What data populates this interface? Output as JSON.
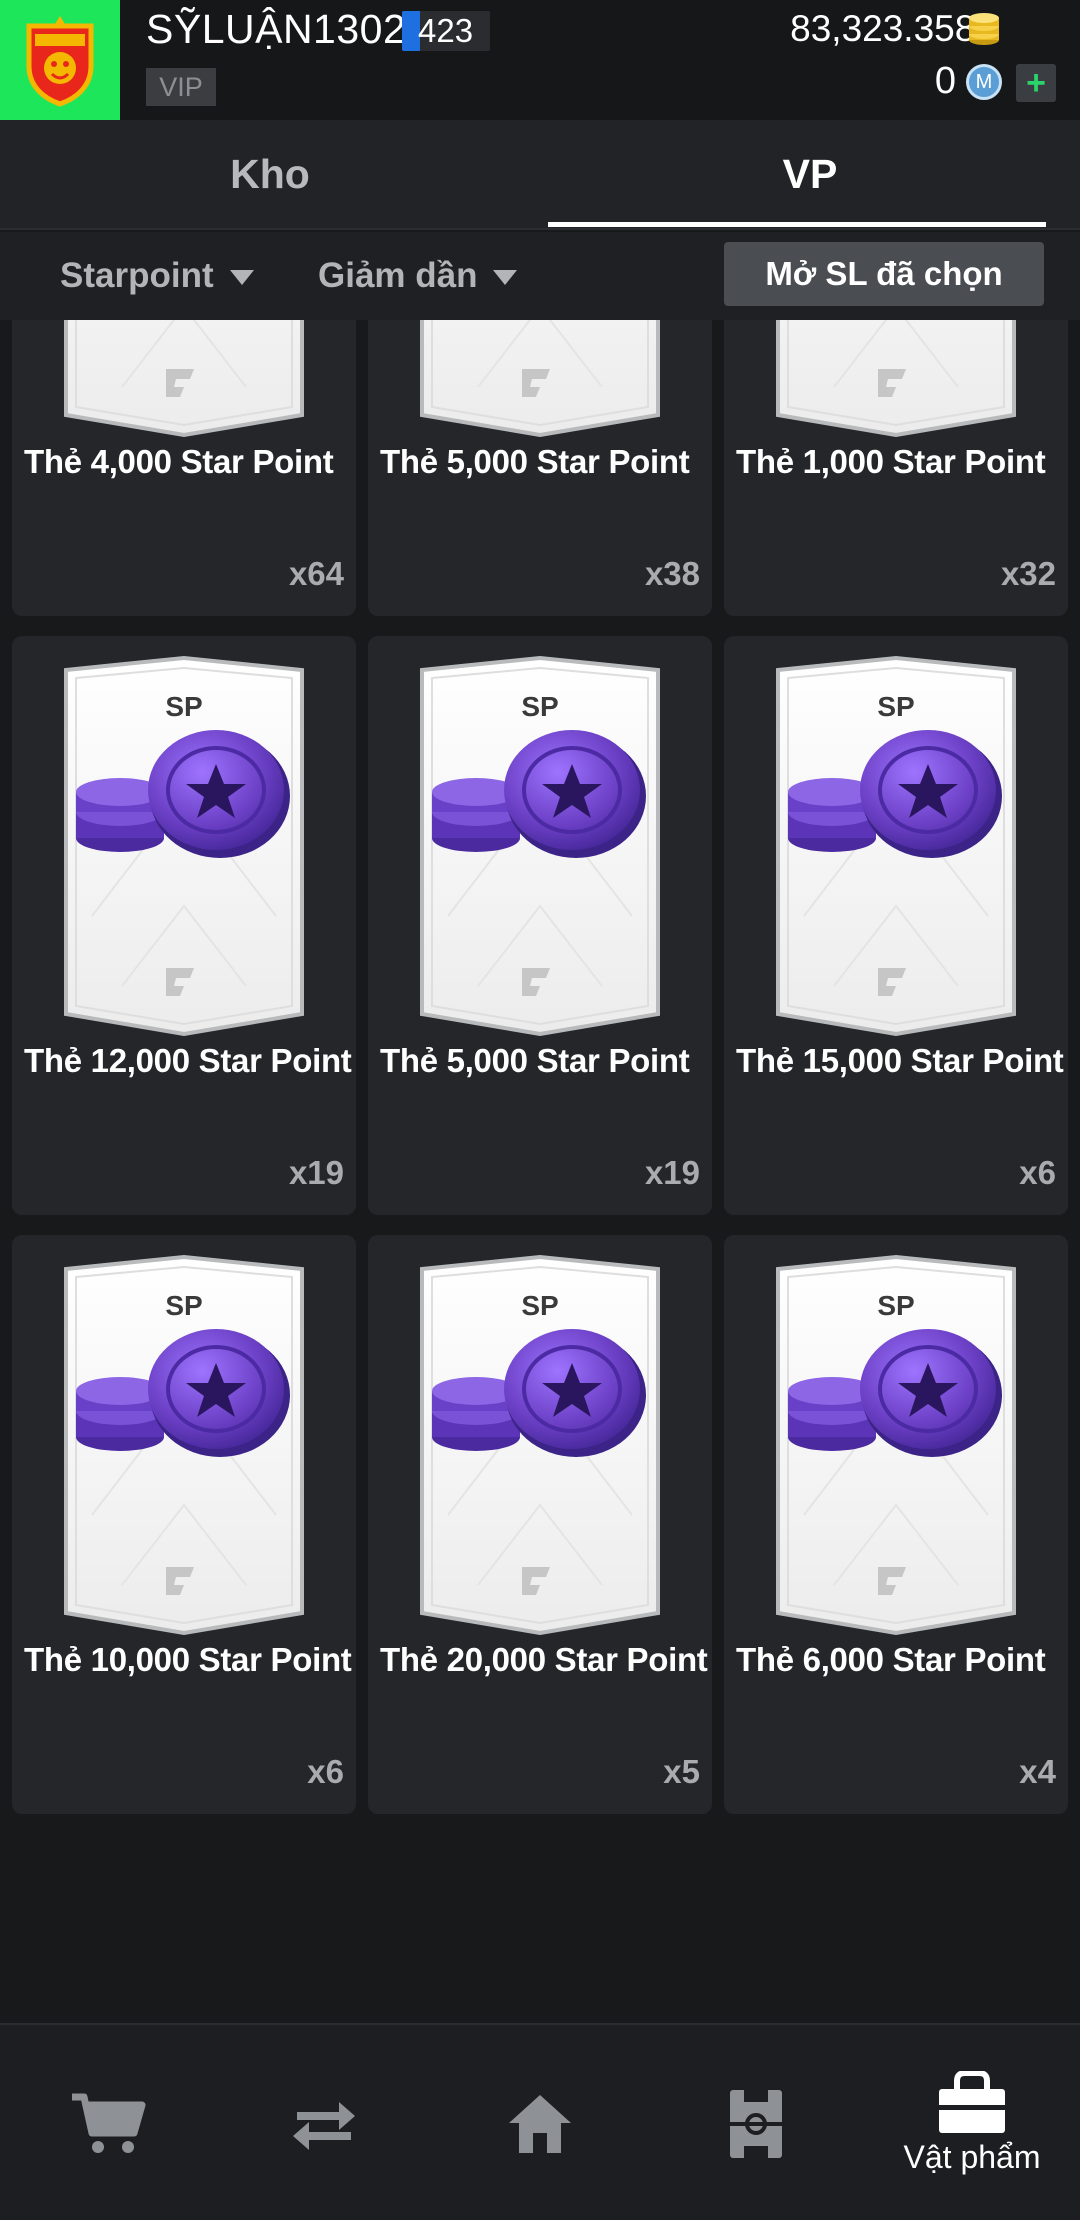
{
  "header": {
    "username": "SỸLUẬN1302",
    "level": "423",
    "level_progress": 0.2,
    "vip_label": "VIP",
    "coins": "83,323.358B",
    "m_coins": "0",
    "m_icon_label": "M",
    "add_label": "+"
  },
  "tabs": [
    {
      "label": "Kho",
      "active": false
    },
    {
      "label": "VP",
      "active": true
    }
  ],
  "filters": {
    "sort_type": "Starpoint",
    "sort_order": "Giảm dần",
    "open_selected_label": "Mở SL đã chọn"
  },
  "card_badge": "SP",
  "items": [
    {
      "name": "Thẻ 4,000 Star Point",
      "qty": "x64"
    },
    {
      "name": "Thẻ 5,000 Star Point",
      "qty": "x38"
    },
    {
      "name": "Thẻ 1,000 Star Point",
      "qty": "x32"
    },
    {
      "name": "Thẻ 12,000 Star Point",
      "qty": "x19"
    },
    {
      "name": "Thẻ 5,000 Star Point",
      "qty": "x19"
    },
    {
      "name": "Thẻ 15,000 Star Point",
      "qty": "x6"
    },
    {
      "name": "Thẻ 10,000 Star Point",
      "qty": "x6"
    },
    {
      "name": "Thẻ 20,000 Star Point",
      "qty": "x5"
    },
    {
      "name": "Thẻ 6,000 Star Point",
      "qty": "x4"
    }
  ],
  "nav": [
    {
      "icon": "cart-icon",
      "label": ""
    },
    {
      "icon": "transfer-icon",
      "label": ""
    },
    {
      "icon": "home-icon",
      "label": ""
    },
    {
      "icon": "pitch-icon",
      "label": ""
    },
    {
      "icon": "bag-icon",
      "label": "Vật phẩm",
      "active": true
    }
  ],
  "colors": {
    "badge_green": "#1ee65a",
    "accent_blue": "#1e6fe0",
    "coin_purple": "#6a3fc4",
    "plus_green": "#2ad36b"
  }
}
